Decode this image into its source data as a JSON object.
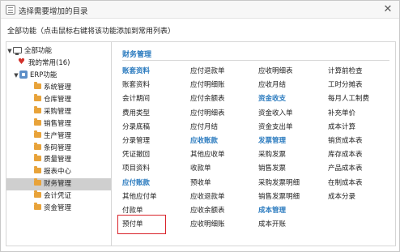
{
  "dialog": {
    "title": "选择需要增加的目录",
    "close_glyph": "✕",
    "instruction": "全部功能（点击鼠标右键将该功能添加到常用列表）"
  },
  "tree": {
    "root": "全部功能",
    "favorites": "我的常用(16)",
    "erp": "ERP功能",
    "modules": [
      "系统管理",
      "仓库管理",
      "采购管理",
      "销售管理",
      "生产管理",
      "条码管理",
      "质量管理",
      "报表中心",
      "财务管理",
      "会计凭证",
      "资金管理"
    ],
    "selected": "财务管理"
  },
  "content": {
    "title": "财务管理",
    "columns": [
      [
        {
          "text": "账套资料",
          "head": true
        },
        {
          "text": "账套资料"
        },
        {
          "text": "会计期间"
        },
        {
          "text": "费用类型"
        },
        {
          "text": "分录底稿"
        },
        {
          "text": "分录管理"
        },
        {
          "text": "凭证撤回"
        },
        {
          "text": "项目资料"
        },
        {
          "text": "应付账款",
          "head": true
        },
        {
          "text": "其他应付单"
        },
        {
          "text": "付款单"
        },
        {
          "text": "预付单",
          "highlight": true
        }
      ],
      [
        {
          "text": "应付退款单"
        },
        {
          "text": "应付明细账"
        },
        {
          "text": "应付余额表"
        },
        {
          "text": "应付明细表"
        },
        {
          "text": "应付月结"
        },
        {
          "text": "应收账款",
          "head": true
        },
        {
          "text": "其他应收单"
        },
        {
          "text": "收款单"
        },
        {
          "text": "预收单"
        },
        {
          "text": "应收退款单"
        },
        {
          "text": "应收余额表"
        },
        {
          "text": "应收明细账"
        }
      ],
      [
        {
          "text": "应收明细表"
        },
        {
          "text": "应收月结"
        },
        {
          "text": "资金收支",
          "head": true
        },
        {
          "text": "资金收入单"
        },
        {
          "text": "资金支出单"
        },
        {
          "text": "发票管理",
          "head": true
        },
        {
          "text": "采购发票"
        },
        {
          "text": "销售发票"
        },
        {
          "text": "采购发票明细"
        },
        {
          "text": "销售发票明细"
        },
        {
          "text": "成本管理",
          "head": true
        },
        {
          "text": "成本开账"
        }
      ],
      [
        {
          "text": "计算前检查"
        },
        {
          "text": "工时分摊表"
        },
        {
          "text": "每月人工制费"
        },
        {
          "text": "补充单价"
        },
        {
          "text": "成本计算"
        },
        {
          "text": "销货成本表"
        },
        {
          "text": "库存成本表"
        },
        {
          "text": "产品成本表"
        },
        {
          "text": "在制成本表"
        },
        {
          "text": "成本分录"
        }
      ]
    ]
  },
  "colors": {
    "accent": "#2b7bbf",
    "highlight_border": "#d9232a",
    "folder": "#e8a33a",
    "selected_bg": "#cfcfcf"
  },
  "icons": {
    "title": "window-icon",
    "root": "monitor-icon",
    "favorites": "heart-icon",
    "erp": "erp-icon",
    "module": "folder-icon"
  }
}
